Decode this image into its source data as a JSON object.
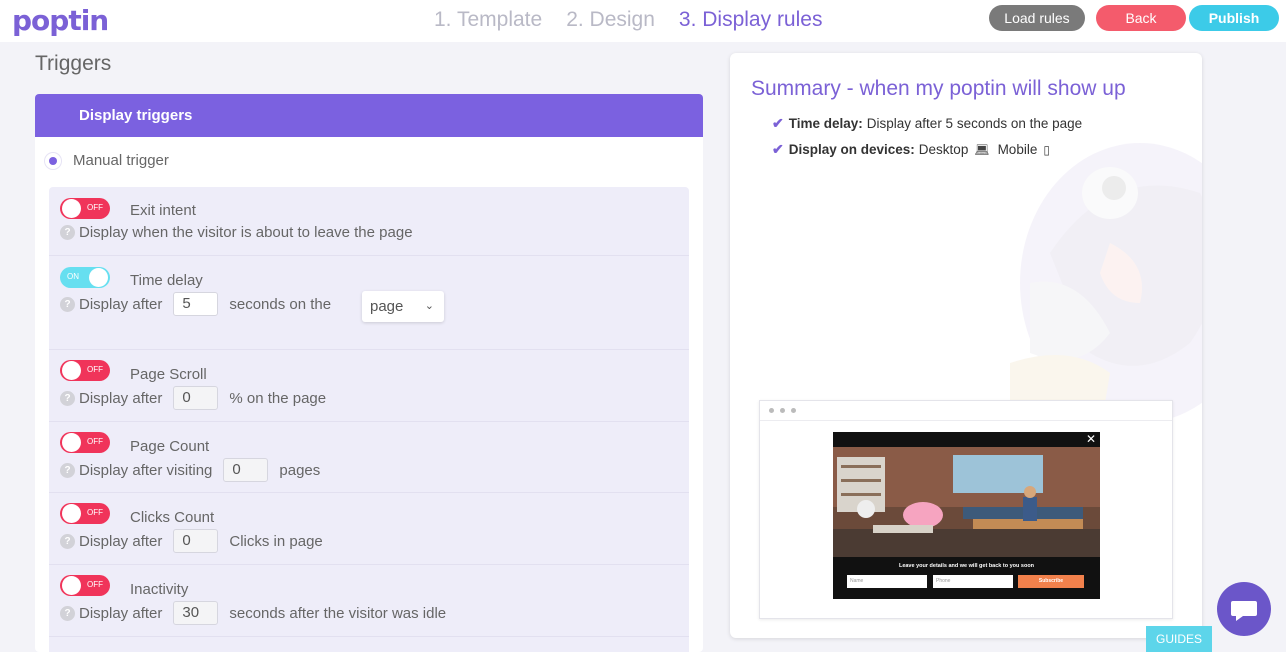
{
  "header": {
    "logo": "poptin",
    "steps": [
      "1. Template",
      "2. Design",
      "3. Display rules"
    ],
    "buttons": {
      "load": "Load rules",
      "back": "Back",
      "publish": "Publish"
    }
  },
  "triggers": {
    "title": "Triggers",
    "panel_title": "Display triggers",
    "manual": "Manual trigger",
    "rules": [
      {
        "toggle": "OFF",
        "title": "Exit intent",
        "desc": "Display when the visitor is about to leave the page"
      },
      {
        "toggle": "ON",
        "title": "Time delay",
        "prefix": "Display after",
        "value": "5",
        "suffix": "seconds on the",
        "select": "page"
      },
      {
        "toggle": "OFF",
        "title": "Page Scroll",
        "prefix": "Display after",
        "value": "0",
        "suffix": "% on the page"
      },
      {
        "toggle": "OFF",
        "title": "Page Count",
        "prefix": "Display after visiting",
        "value": "0",
        "suffix": "pages"
      },
      {
        "toggle": "OFF",
        "title": "Clicks Count",
        "prefix": "Display after",
        "value": "0",
        "suffix": "Clicks in page"
      },
      {
        "toggle": "OFF",
        "title": "Inactivity",
        "prefix": "Display after",
        "value": "30",
        "suffix": "seconds after the visitor was idle"
      }
    ]
  },
  "summary": {
    "title": "Summary - when my poptin will show up",
    "time_delay_label": "Time delay:",
    "time_delay_value": "Display after 5 seconds on the page",
    "devices_label": "Display on devices:",
    "desktop": "Desktop",
    "mobile": "Mobile"
  },
  "preview": {
    "headline": "Leave your details and we will get back to you soon",
    "name_placeholder": "Name",
    "phone_placeholder": "Phone",
    "subscribe": "Subscribe",
    "close": "✕"
  },
  "guides": "GUIDES",
  "colors": {
    "brand": "#7b61e0",
    "on": "#66dff0",
    "off": "#f0345a",
    "publish": "#3ccbe8",
    "back": "#f45b6c"
  }
}
